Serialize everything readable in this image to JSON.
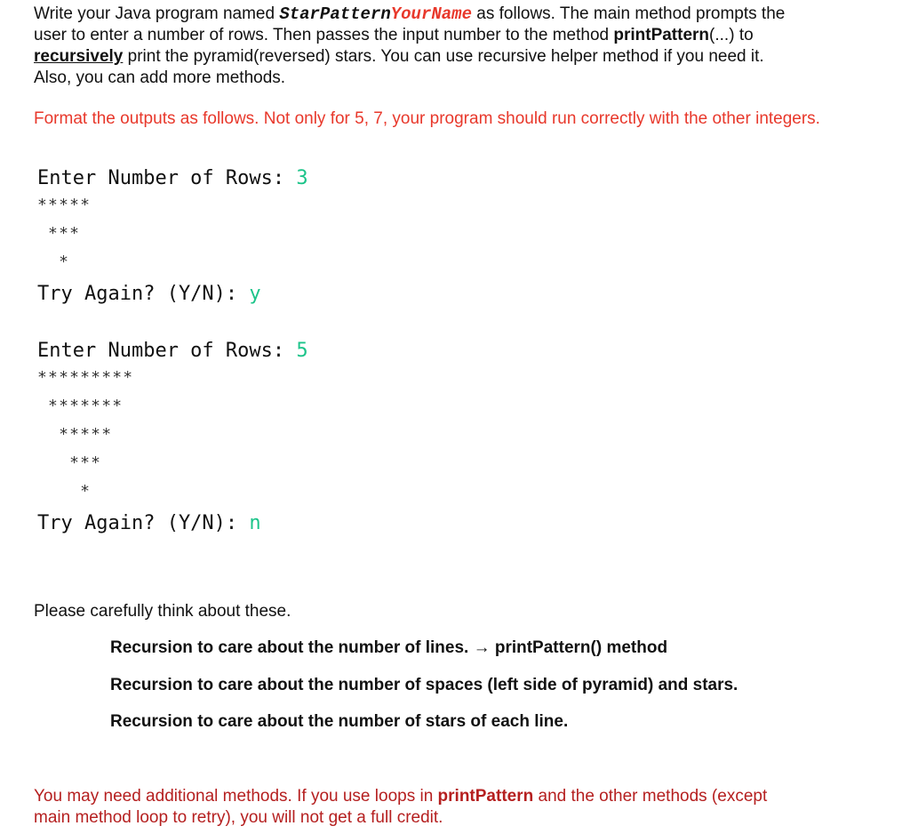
{
  "intro": {
    "prefix": "Write your Java program named ",
    "class_name_part1": "StarPattern",
    "class_name_part2": "YourName",
    "after_name": " as follows. The main method prompts the",
    "line2_prefix": "user to enter a number of rows. Then passes the input number to the method ",
    "method_name": "printPattern",
    "line2_suffix": "(...) to",
    "recursively": "recursively",
    "line3_suffix": " print the pyramid(reversed) stars. You can use recursive helper method if you need it.",
    "line4": "Also, you can add more methods."
  },
  "format_note": "Format the outputs as follows. Not only for 5, 7, your program should run correctly with the other integers.",
  "sample1": {
    "prompt": "Enter Number of Rows: ",
    "input": "3",
    "rows": [
      "*****",
      " ***",
      "  *"
    ],
    "retry_prompt": "Try Again? (Y/N): ",
    "retry_input": "y"
  },
  "sample2": {
    "prompt": "Enter Number of Rows: ",
    "input": "5",
    "rows": [
      "*********",
      " *******",
      "  *****",
      "   ***",
      "    *"
    ],
    "retry_prompt": "Try Again? (Y/N): ",
    "retry_input": "n"
  },
  "think": {
    "heading": "Please carefully think about these.",
    "items": [
      "Recursion to care about the number of lines. → printPattern() method",
      "Recursion to care about the number of spaces (left side of pyramid) and stars.",
      "Recursion to care about the number of stars of each line."
    ]
  },
  "footer": {
    "prefix": "You may need additional methods. If you use loops in ",
    "method_name": "printPattern",
    "suffix": " and the other methods (except",
    "line2": "main method loop to retry), you will not get a full credit."
  },
  "colors": {
    "accent_red": "#e8382b",
    "dark_red": "#b51f1f",
    "console_input_green": "#1dc48a"
  }
}
